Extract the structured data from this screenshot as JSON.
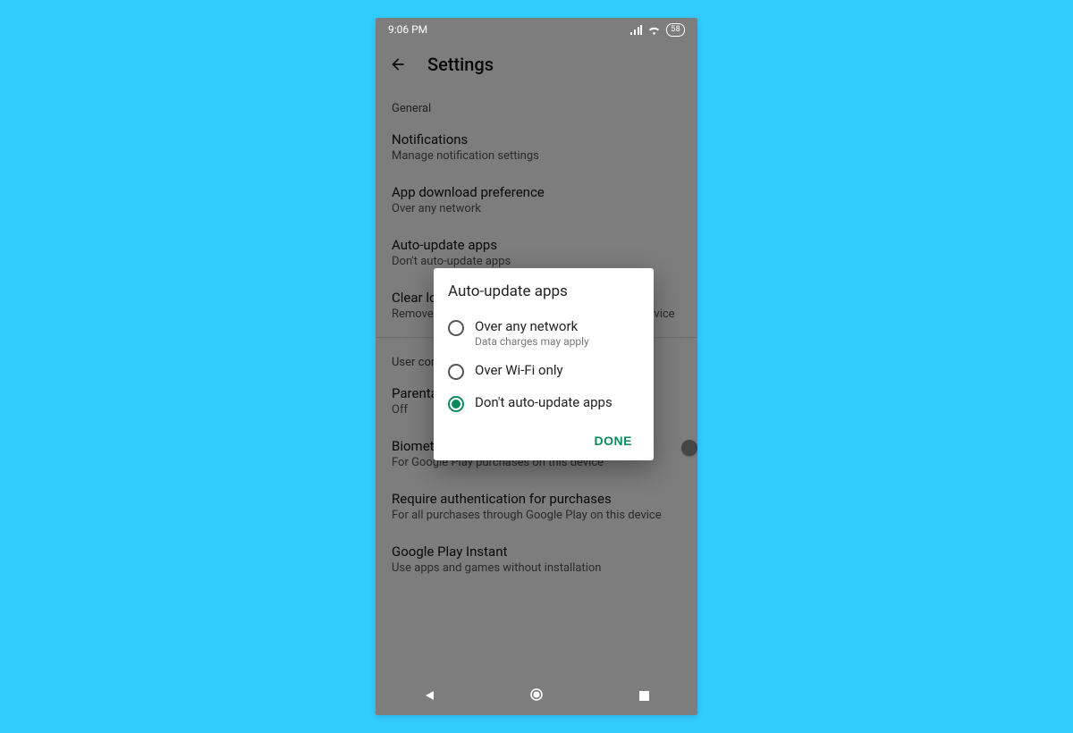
{
  "statusbar": {
    "time": "9:06 PM",
    "battery": "58"
  },
  "appbar": {
    "title": "Settings"
  },
  "sections": {
    "general_label": "General",
    "user_controls_label": "User controls"
  },
  "rows": {
    "notifications": {
      "title": "Notifications",
      "sub": "Manage notification settings"
    },
    "download_pref": {
      "title": "App download preference",
      "sub": "Over any network"
    },
    "auto_update": {
      "title": "Auto-update apps",
      "sub": "Don't auto-update apps"
    },
    "clear_history": {
      "title": "Clear local search history",
      "sub": "Remove searches you have performed from this device"
    },
    "parental": {
      "title": "Parental controls",
      "sub": "Off"
    },
    "biometric": {
      "title": "Biometric authentication",
      "sub": "For Google Play purchases on this device"
    },
    "require_auth": {
      "title": "Require authentication for purchases",
      "sub": "For all purchases through Google Play on this device"
    },
    "instant": {
      "title": "Google Play Instant",
      "sub": "Use apps and games without installation"
    }
  },
  "dialog": {
    "title": "Auto-update apps",
    "options": [
      {
        "label": "Over any network",
        "sub": "Data charges may apply",
        "selected": false
      },
      {
        "label": "Over Wi-Fi only",
        "sub": "",
        "selected": false
      },
      {
        "label": "Don't auto-update apps",
        "sub": "",
        "selected": true
      }
    ],
    "done": "DONE"
  }
}
